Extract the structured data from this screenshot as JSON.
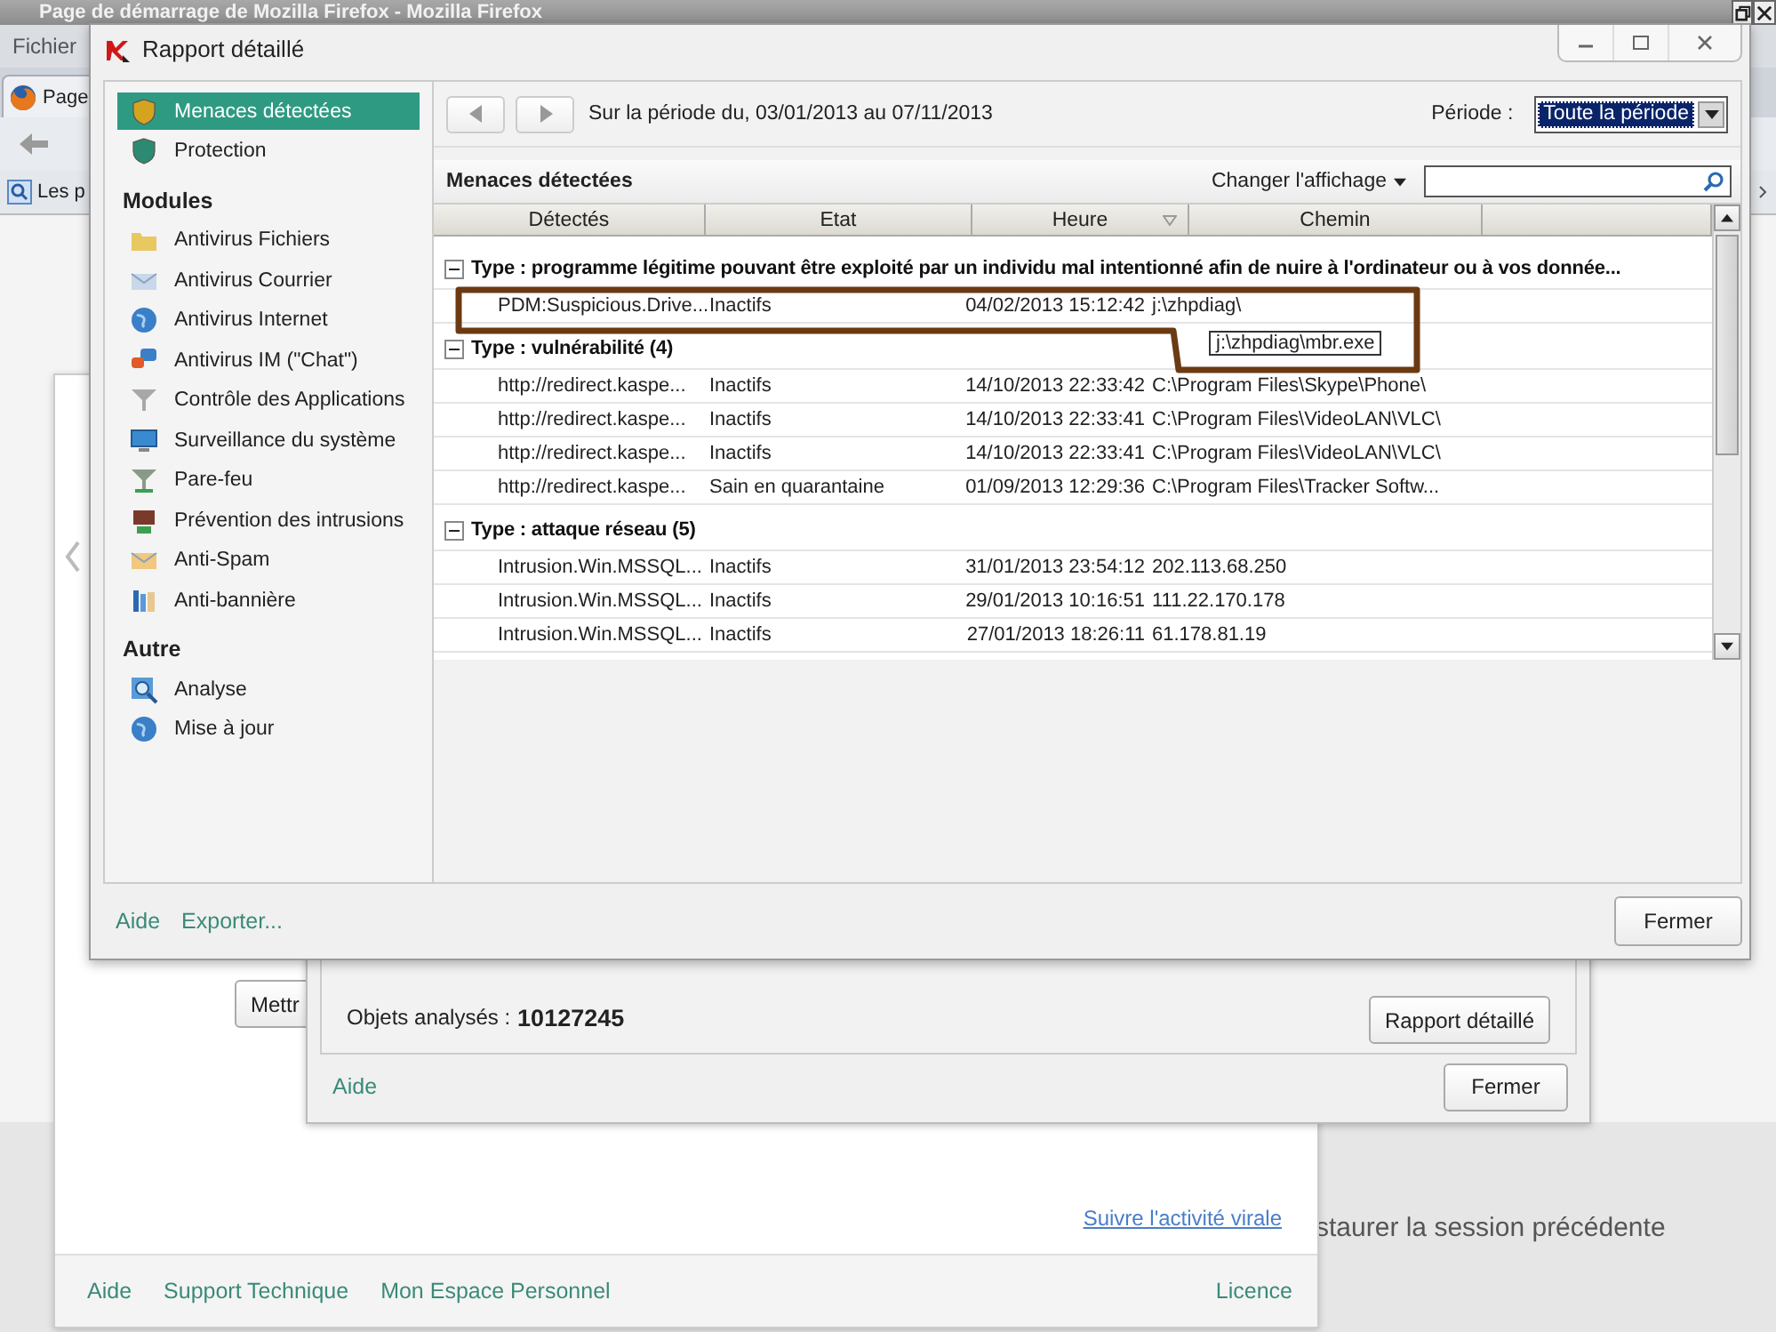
{
  "browser": {
    "title": "Page de démarrage de Mozilla Firefox - Mozilla Firefox",
    "menu": "Fichier",
    "tab": "Page",
    "bookmark": "Les p",
    "page_text": "staurer la session précédente"
  },
  "main_window": {
    "button": "Mettr",
    "link": "Suivre l'activité virale",
    "footer_links": [
      "Aide",
      "Support Technique",
      "Mon Espace Personnel"
    ],
    "license_link": "Licence"
  },
  "scan_dialog": {
    "label": "Objets analysés :",
    "value": "10127245",
    "report_button": "Rapport détaillé",
    "help_link": "Aide",
    "close_button": "Fermer"
  },
  "report_dialog": {
    "title": "Rapport détaillé",
    "sidebar": [
      {
        "items": [
          {
            "label": "Menaces détectées",
            "selected": true
          },
          {
            "label": "Protection",
            "selected": false
          }
        ]
      },
      {
        "heading": "Modules",
        "items": [
          {
            "label": "Antivirus Fichiers",
            "selected": false
          },
          {
            "label": "Antivirus Courrier",
            "selected": false
          },
          {
            "label": "Antivirus Internet",
            "selected": false
          },
          {
            "label": "Antivirus IM (\"Chat\")",
            "selected": false
          },
          {
            "label": "Contrôle des Applications",
            "selected": false
          },
          {
            "label": "Surveillance du système",
            "selected": false
          },
          {
            "label": "Pare-feu",
            "selected": false
          },
          {
            "label": "Prévention des intrusions",
            "selected": false
          },
          {
            "label": "Anti-Spam",
            "selected": false
          },
          {
            "label": "Anti-bannière",
            "selected": false
          }
        ]
      },
      {
        "heading": "Autre",
        "items": [
          {
            "label": "Analyse",
            "selected": false
          },
          {
            "label": "Mise à jour",
            "selected": false
          }
        ]
      }
    ],
    "period_text": "Sur la période du, 03/01/2013 au 07/11/2013",
    "period_label": "Période :",
    "period_value": "Toute la période",
    "section_title": "Menaces détectées",
    "view_menu": "Changer l'affichage",
    "table": {
      "columns": [
        {
          "label": "Détectés",
          "sorted": false
        },
        {
          "label": "Etat",
          "sorted": false
        },
        {
          "label": "Heure",
          "sorted": true
        },
        {
          "label": "Chemin",
          "sorted": false
        }
      ],
      "groups": [
        {
          "label": "Type : programme légitime pouvant être exploité par un individu mal intentionné afin de nuire à l'ordinateur ou à vos donnée...",
          "expanded": true,
          "rows": [
            [
              "PDM:Suspicious.Drive...",
              "Inactifs",
              "04/02/2013 15:12:42",
              "j:\\zhpdiag\\"
            ]
          ]
        },
        {
          "label": "Type : vulnérabilité (4)",
          "expanded": true,
          "rows": [
            [
              "http://redirect.kaspe...",
              "Inactifs",
              "14/10/2013 22:33:42",
              "C:\\Program Files\\Skype\\Phone\\"
            ],
            [
              "http://redirect.kaspe...",
              "Inactifs",
              "14/10/2013 22:33:41",
              "C:\\Program Files\\VideoLAN\\VLC\\"
            ],
            [
              "http://redirect.kaspe...",
              "Inactifs",
              "14/10/2013 22:33:41",
              "C:\\Program Files\\VideoLAN\\VLC\\"
            ],
            [
              "http://redirect.kaspe...",
              "Sain en quarantaine",
              "01/09/2013 12:29:36",
              "C:\\Program Files\\Tracker Softw..."
            ]
          ]
        },
        {
          "label": "Type : attaque réseau (5)",
          "expanded": true,
          "rows": [
            [
              "Intrusion.Win.MSSQL...",
              "Inactifs",
              "31/01/2013 23:54:12",
              "202.113.68.250"
            ],
            [
              "Intrusion.Win.MSSQL...",
              "Inactifs",
              "29/01/2013 10:16:51",
              "111.22.170.178"
            ],
            [
              "Intrusion.Win.MSSQL...",
              "Inactifs",
              "27/01/2013 18:26:11",
              "61.178.81.19"
            ]
          ]
        }
      ]
    },
    "tooltip": "j:\\zhpdiag\\mbr.exe",
    "footer_links": [
      "Aide",
      "Exporter..."
    ],
    "close_button": "Fermer"
  }
}
